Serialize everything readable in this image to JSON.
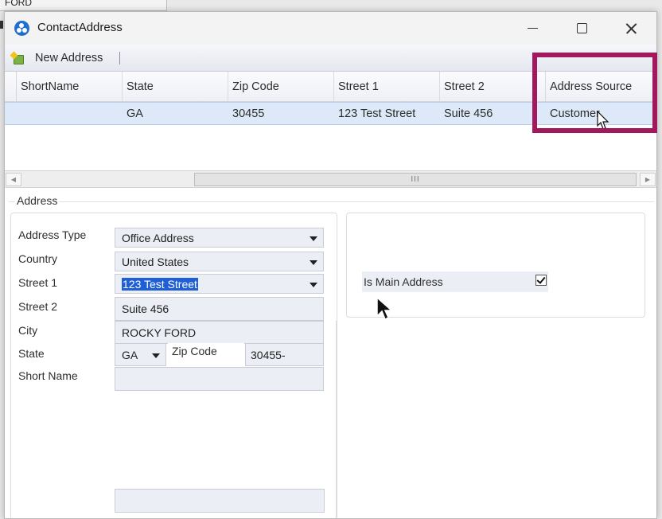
{
  "background": {
    "strip_text": "FORD"
  },
  "window": {
    "title": "ContactAddress"
  },
  "toolbar": {
    "new_address_label": "New Address"
  },
  "grid": {
    "columns": [
      "ShortName",
      "State",
      "Zip Code",
      "Street 1",
      "Street 2",
      "Address Source"
    ],
    "rows": [
      {
        "shortname": "",
        "state": "GA",
        "zip": "30455",
        "street1": "123 Test Street",
        "street2": "Suite 456",
        "source": "Customer"
      }
    ]
  },
  "scrollbar": {
    "thumb_grip": "III"
  },
  "address": {
    "group_label": "Address",
    "address_type": {
      "label": "Address Type",
      "value": "Office Address"
    },
    "country": {
      "label": "Country",
      "value": "United States"
    },
    "street1": {
      "label": "Street 1",
      "value": "123 Test Street"
    },
    "street2": {
      "label": "Street 2",
      "value": "Suite 456"
    },
    "city": {
      "label": "City",
      "value": "ROCKY FORD"
    },
    "state": {
      "label": "State",
      "value": "GA"
    },
    "zip": {
      "label": "Zip Code",
      "value": "30455-"
    },
    "short_name": {
      "label": "Short Name",
      "value": ""
    },
    "is_main": {
      "label": "Is Main Address",
      "checked": true
    }
  },
  "colors": {
    "highlight": "#a3185c",
    "selection": "#1e5fd6",
    "row_selected": "#dde9f8"
  }
}
